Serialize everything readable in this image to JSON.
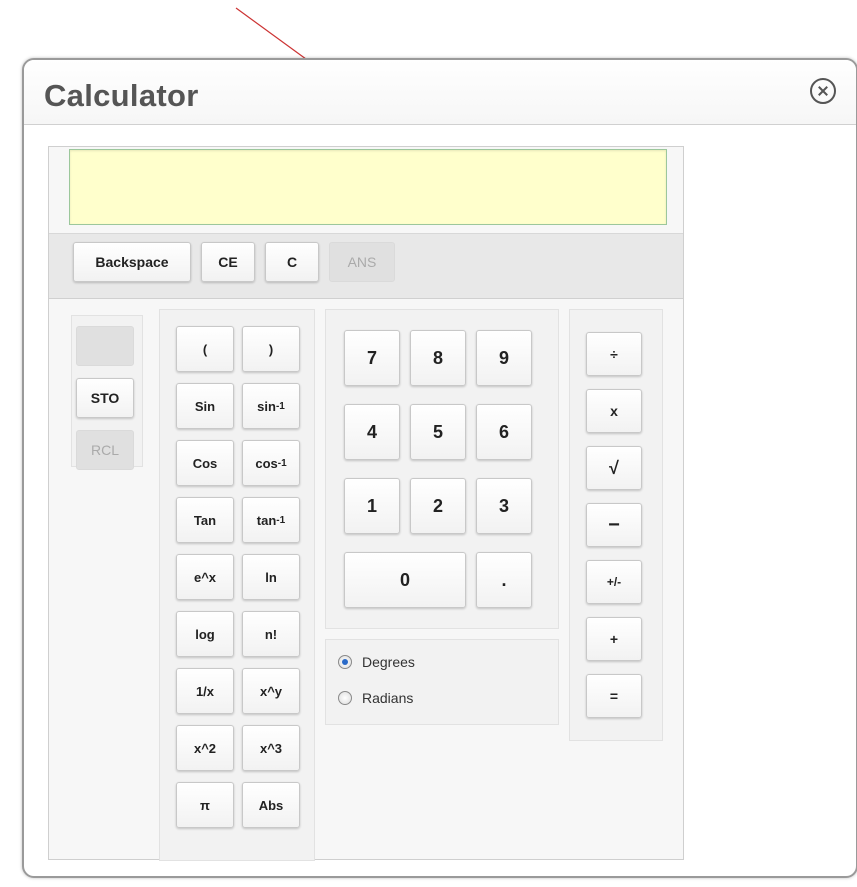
{
  "window": {
    "title": "Calculator"
  },
  "display": {
    "value": ""
  },
  "top_buttons": [
    {
      "label": "Backspace",
      "enabled": true
    },
    {
      "label": "CE",
      "enabled": true
    },
    {
      "label": "C",
      "enabled": true
    },
    {
      "label": "ANS",
      "enabled": false
    }
  ],
  "memory": {
    "display": "",
    "sto": "STO",
    "rcl": "RCL"
  },
  "functions": [
    [
      "(",
      ")"
    ],
    [
      "Sin",
      "sin-1"
    ],
    [
      "Cos",
      "cos-1"
    ],
    [
      "Tan",
      "tan-1"
    ],
    [
      "e^x",
      "ln"
    ],
    [
      "log",
      "n!"
    ],
    [
      "1/x",
      "x^y"
    ],
    [
      "x^2",
      "x^3"
    ],
    [
      "π",
      "Abs"
    ]
  ],
  "digits": [
    [
      "7",
      "8",
      "9"
    ],
    [
      "4",
      "5",
      "6"
    ],
    [
      "1",
      "2",
      "3"
    ],
    [
      "0",
      "."
    ]
  ],
  "angle_mode": {
    "options": [
      "Degrees",
      "Radians"
    ],
    "selected": "Degrees"
  },
  "operators": [
    "÷",
    "x",
    "√",
    "−",
    "+/-",
    "+",
    "="
  ],
  "colors": {
    "display_bg": "#ffffcc",
    "radio_selected": "#2a6ac8",
    "annotation_arrow": "#cc3333"
  }
}
